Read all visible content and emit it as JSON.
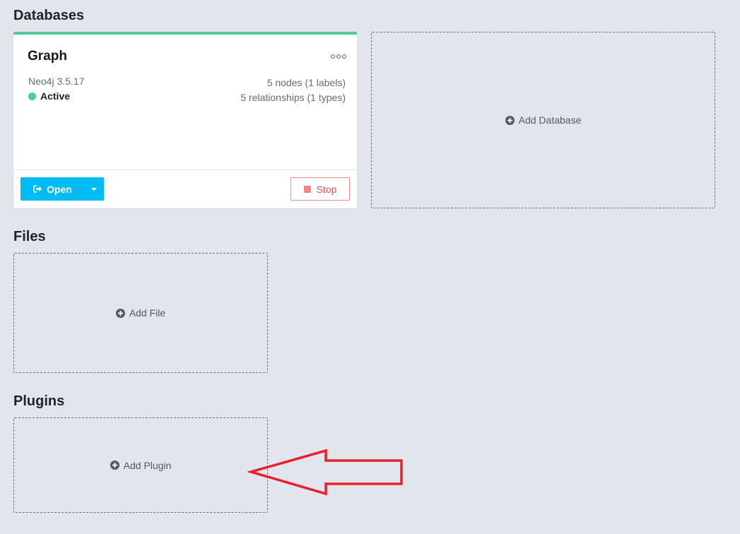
{
  "sections": {
    "databases": "Databases",
    "files": "Files",
    "plugins": "Plugins"
  },
  "database_card": {
    "name": "Graph",
    "version": "Neo4j 3.5.17",
    "status": "Active",
    "nodes": "5 nodes (1 labels)",
    "relationships": "5 relationships (1 types)",
    "open_label": "Open",
    "stop_label": "Stop",
    "accent_color": "#52cc95"
  },
  "add_database": {
    "label": "Add Database",
    "icon": "plus-circle-icon"
  },
  "add_file": {
    "label": "Add File",
    "icon": "plus-circle-icon"
  },
  "add_plugin": {
    "label": "Add Plugin",
    "icon": "plus-circle-icon"
  },
  "annotation": {
    "type": "arrow-left",
    "color": "#e8202a"
  }
}
